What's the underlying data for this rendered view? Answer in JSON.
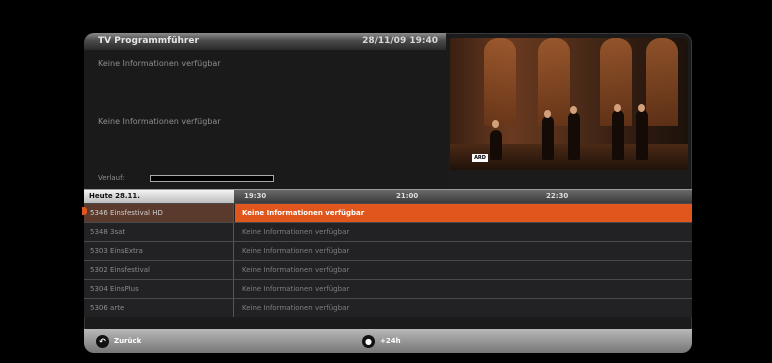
{
  "header": {
    "title": "TV Programmführer",
    "datetime": "28/11/09 19:40"
  },
  "info": {
    "line1": "Keine Informationen verfügbar",
    "line2": "Keine Informationen verfügbar",
    "progress_label": "Verlauf:",
    "progress_fraction": 0.0
  },
  "video": {
    "overlay_chip": "ARD"
  },
  "timeline": {
    "day_label": "Heute 28.11.",
    "ticks": [
      "19:30",
      "21:00",
      "22:30"
    ]
  },
  "rows": [
    {
      "channel": "5346 Einsfestival HD",
      "program": "Keine Informationen verfügbar",
      "selected": true
    },
    {
      "channel": "5348 3sat",
      "program": "Keine Informationen verfügbar",
      "selected": false
    },
    {
      "channel": "5303 EinsExtra",
      "program": "Keine Informationen verfügbar",
      "selected": false
    },
    {
      "channel": "5302 Einsfestival",
      "program": "Keine Informationen verfügbar",
      "selected": false
    },
    {
      "channel": "5304 EinsPlus",
      "program": "Keine Informationen verfügbar",
      "selected": false
    },
    {
      "channel": "5306 arte",
      "program": "Keine Informationen verfügbar",
      "selected": false
    }
  ],
  "footer": {
    "back_label": "Zurück",
    "next_label": "+24h"
  },
  "colors": {
    "highlight": "#e0561c"
  }
}
